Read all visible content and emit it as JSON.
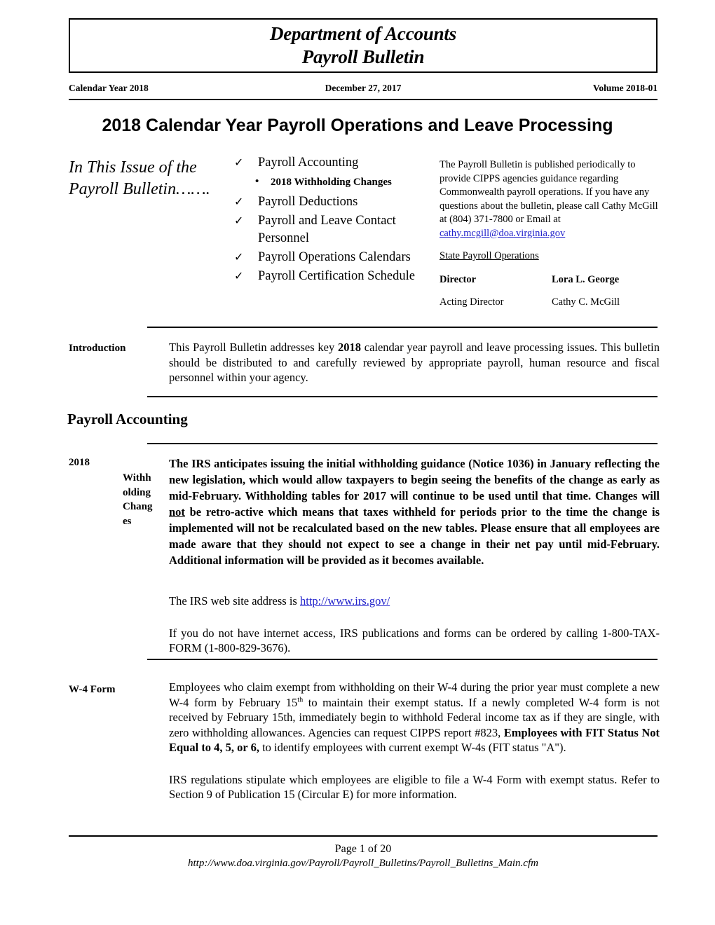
{
  "masthead": {
    "line1": "Department of Accounts",
    "line2": "Payroll Bulletin"
  },
  "issue_line": {
    "calendar_year": "Calendar Year  2018",
    "date": "December 27, 2017",
    "volume": "Volume 2018-01"
  },
  "main_title": "2018 Calendar Year Payroll Operations and Leave Processing",
  "in_this_issue": {
    "heading": "In This Issue of the Payroll Bulletin…….",
    "check_glyph": "✓",
    "bullet_glyph": "•",
    "items": [
      {
        "label": "Payroll Accounting"
      },
      {
        "label": "Payroll Deductions"
      },
      {
        "label": "Payroll and Leave Contact Personnel"
      },
      {
        "label": "Payroll Operations Calendars"
      },
      {
        "label": "Payroll Certification Schedule"
      }
    ],
    "sub_item": "2018 Withholding Changes"
  },
  "info": {
    "paragraph_before_email": "The Payroll Bulletin is published periodically to provide CIPPS agencies guidance regarding Commonwealth payroll operations.  If you have any questions about the bulletin, please call Cathy McGill at (804) 371-7800 or Email at ",
    "email": "cathy.mcgill@doa.virginia.gov",
    "email_color": "#2222cc",
    "section_title": "State Payroll Operations",
    "staff": [
      {
        "role": "Director",
        "name": "Lora L. George",
        "bold": true
      },
      {
        "role": "Acting Director",
        "name": "Cathy C. McGill",
        "bold": false
      }
    ]
  },
  "sections": {
    "introduction": {
      "label": "Introduction",
      "text_part1": "This Payroll Bulletin addresses key ",
      "text_bold": "2018",
      "text_part2": " calendar year payroll and leave processing issues.  This bulletin should be distributed to and carefully reviewed by appropriate payroll, human resource and fiscal personnel within your agency."
    },
    "payroll_accounting_heading": "Payroll Accounting",
    "withholding": {
      "label_year": "2018",
      "label_rest": "Withholding Changes",
      "para1_a": "The IRS anticipates issuing the initial withholding guidance (Notice 1036) in January reflecting the new legislation, which would allow taxpayers to begin seeing the benefits of the change as early as mid-February.  Withholding tables for 2017 will continue to be used until that time.  Changes will ",
      "para1_underline": "not",
      "para1_b": " be retro-active which means that taxes withheld for periods prior to the time the change is implemented will not be recalculated based on the new tables.  Please ensure that all employees are made aware that they should not expect to see a change in their net pay until mid-February.  Additional information will be provided as it becomes available.",
      "para2_lead": "The IRS web site address is ",
      "para2_link": "http://www.irs.gov/",
      "para3": "If you do not have internet access, IRS publications and forms can be ordered by calling 1-800-TAX-FORM (1-800-829-3676)."
    },
    "w4": {
      "label": "W-4 Form",
      "para1_a": "Employees who claim exempt from withholding on their W-4 during the prior year must complete a new W-4 form by February 15",
      "para1_sup": "th",
      "para1_b": " to maintain their exempt status. If a newly completed W-4 form is not received by February 15th, immediately begin to withhold Federal income tax as if they are single, with zero withholding allowances. Agencies can request CIPPS report #823, ",
      "para1_bold": "Employees with FIT Status Not Equal to 4, 5, or 6,",
      "para1_c": " to identify employees with current exempt W-4s (FIT status \"A\").",
      "para2": "IRS regulations stipulate which employees are eligible to file a W-4 Form with exempt status.  Refer to Section 9 of Publication 15 (Circular E) for more information."
    }
  },
  "footer": {
    "page_number": "Page 1 of 20",
    "url": "http://www.doa.virginia.gov/Payroll/Payroll_Bulletins/Payroll_Bulletins_Main.cfm"
  }
}
